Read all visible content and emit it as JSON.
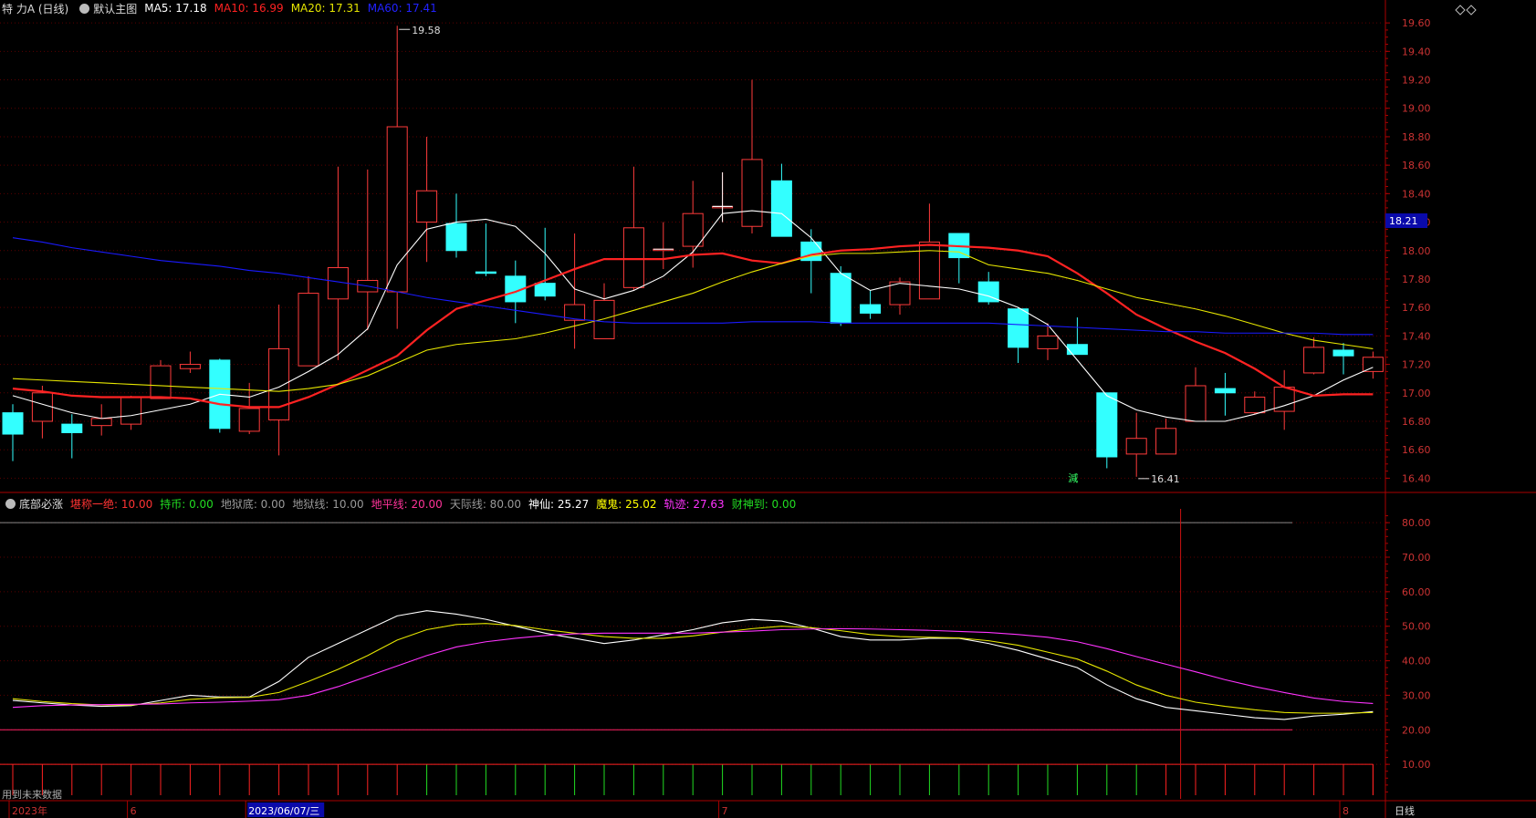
{
  "header_main": {
    "stock": "特 力A (日线)",
    "template": "默认主图",
    "ma5_label": "MA5: 17.18",
    "ma10_label": "MA10: 16.99",
    "ma20_label": "MA20: 17.31",
    "ma60_label": "MA60: 17.41",
    "diamond_icon": "diamond-icon"
  },
  "header_sub": {
    "name": "底部必涨",
    "items": [
      {
        "text": "堪称一绝: 10.00",
        "color": "#ff3333"
      },
      {
        "text": "持币: 0.00",
        "color": "#22dd22"
      },
      {
        "text": "地狱底: 0.00",
        "color": "#999999"
      },
      {
        "text": "地狱线: 10.00",
        "color": "#999999"
      },
      {
        "text": "地平线: 20.00",
        "color": "#ff3399"
      },
      {
        "text": "天际线: 80.00",
        "color": "#999999"
      },
      {
        "text": "神仙: 25.27",
        "color": "#ffffff"
      },
      {
        "text": "魔鬼: 25.02",
        "color": "#ffff00"
      },
      {
        "text": "轨迹: 27.63",
        "color": "#ff33ff"
      },
      {
        "text": "财神到: 0.00",
        "color": "#22dd22"
      }
    ]
  },
  "annotations": {
    "high_label": "19.58",
    "low_label": "16.41",
    "signal": "減",
    "price_marker": "18.21"
  },
  "footer": {
    "no_future": "用到未来数据",
    "period": "日线",
    "x_labels": [
      {
        "text": "2023年",
        "idx": 0
      },
      {
        "text": "6",
        "idx": 4
      },
      {
        "text": "2023/06/07/三",
        "idx": 8
      },
      {
        "text": "7",
        "idx": 24
      },
      {
        "text": "8",
        "idx": 45
      }
    ]
  },
  "chart_data": [
    {
      "type": "candlestick",
      "ylim": [
        16.3,
        19.62
      ],
      "yticks": [
        16.4,
        16.6,
        16.8,
        17.0,
        17.2,
        17.4,
        17.6,
        17.8,
        18.0,
        18.2,
        18.4,
        18.6,
        18.8,
        19.0,
        19.2,
        19.4,
        19.6
      ],
      "candles": [
        {
          "o": 16.86,
          "c": 16.71,
          "h": 16.92,
          "l": 16.52
        },
        {
          "o": 16.8,
          "c": 17.0,
          "h": 17.05,
          "l": 16.68
        },
        {
          "o": 16.78,
          "c": 16.72,
          "h": 16.85,
          "l": 16.54
        },
        {
          "o": 16.77,
          "c": 16.82,
          "h": 16.92,
          "l": 16.7
        },
        {
          "o": 16.78,
          "c": 16.97,
          "h": 16.98,
          "l": 16.74
        },
        {
          "o": 16.96,
          "c": 17.19,
          "h": 17.23,
          "l": 16.96
        },
        {
          "o": 17.17,
          "c": 17.2,
          "h": 17.29,
          "l": 17.14
        },
        {
          "o": 17.23,
          "c": 16.75,
          "h": 17.24,
          "l": 16.72
        },
        {
          "o": 16.73,
          "c": 16.89,
          "h": 17.07,
          "l": 16.71
        },
        {
          "o": 16.81,
          "c": 17.31,
          "h": 17.62,
          "l": 16.56
        },
        {
          "o": 17.19,
          "c": 17.7,
          "h": 17.82,
          "l": 17.19
        },
        {
          "o": 17.66,
          "c": 17.88,
          "h": 18.59,
          "l": 17.23
        },
        {
          "o": 17.71,
          "c": 17.79,
          "h": 18.57,
          "l": 17.44
        },
        {
          "o": 17.71,
          "c": 18.87,
          "h": 19.58,
          "l": 17.45
        },
        {
          "o": 18.2,
          "c": 18.42,
          "h": 18.8,
          "l": 17.92
        },
        {
          "o": 18.19,
          "c": 18.0,
          "h": 18.4,
          "l": 17.95
        },
        {
          "o": 17.85,
          "c": 17.84,
          "h": 18.19,
          "l": 17.82
        },
        {
          "o": 17.82,
          "c": 17.64,
          "h": 17.93,
          "l": 17.49
        },
        {
          "o": 17.77,
          "c": 17.68,
          "h": 18.16,
          "l": 17.65
        },
        {
          "o": 17.51,
          "c": 17.62,
          "h": 18.12,
          "l": 17.31
        },
        {
          "o": 17.38,
          "c": 17.65,
          "h": 17.77,
          "l": 17.38
        },
        {
          "o": 17.74,
          "c": 18.16,
          "h": 18.59,
          "l": 17.72
        },
        {
          "o": 18.01,
          "c": 18.01,
          "h": 18.2,
          "l": 17.87
        },
        {
          "o": 18.03,
          "c": 18.26,
          "h": 18.49,
          "l": 17.88
        },
        {
          "o": 18.31,
          "c": 18.31,
          "h": 18.55,
          "l": 18.2
        },
        {
          "o": 18.17,
          "c": 18.64,
          "h": 19.2,
          "l": 18.12
        },
        {
          "o": 18.49,
          "c": 18.1,
          "h": 18.61,
          "l": 18.1
        },
        {
          "o": 18.06,
          "c": 17.93,
          "h": 18.15,
          "l": 17.7
        },
        {
          "o": 17.84,
          "c": 17.49,
          "h": 17.89,
          "l": 17.47
        },
        {
          "o": 17.62,
          "c": 17.56,
          "h": 17.72,
          "l": 17.52
        },
        {
          "o": 17.62,
          "c": 17.78,
          "h": 17.81,
          "l": 17.55
        },
        {
          "o": 17.66,
          "c": 18.06,
          "h": 18.33,
          "l": 17.66
        },
        {
          "o": 18.12,
          "c": 17.95,
          "h": 18.12,
          "l": 17.77
        },
        {
          "o": 17.78,
          "c": 17.64,
          "h": 17.85,
          "l": 17.62
        },
        {
          "o": 17.59,
          "c": 17.32,
          "h": 17.6,
          "l": 17.21
        },
        {
          "o": 17.31,
          "c": 17.4,
          "h": 17.49,
          "l": 17.23
        },
        {
          "o": 17.34,
          "c": 17.27,
          "h": 17.53,
          "l": 17.27
        },
        {
          "o": 17.0,
          "c": 16.55,
          "h": 17.0,
          "l": 16.47
        },
        {
          "o": 16.57,
          "c": 16.68,
          "h": 16.86,
          "l": 16.41
        },
        {
          "o": 16.57,
          "c": 16.75,
          "h": 16.82,
          "l": 16.57
        },
        {
          "o": 16.8,
          "c": 17.05,
          "h": 17.18,
          "l": 16.8
        },
        {
          "o": 17.03,
          "c": 17.0,
          "h": 17.14,
          "l": 16.84
        },
        {
          "o": 16.86,
          "c": 16.97,
          "h": 17.01,
          "l": 16.85
        },
        {
          "o": 16.87,
          "c": 17.04,
          "h": 17.16,
          "l": 16.74
        },
        {
          "o": 17.14,
          "c": 17.32,
          "h": 17.39,
          "l": 17.13
        },
        {
          "o": 17.3,
          "c": 17.26,
          "h": 17.35,
          "l": 17.13
        },
        {
          "o": 17.15,
          "c": 17.25,
          "h": 17.29,
          "l": 17.1
        }
      ],
      "series": [
        {
          "name": "MA5",
          "color": "#ffffff",
          "values": [
            16.98,
            16.92,
            16.86,
            16.82,
            16.84,
            16.88,
            16.92,
            16.99,
            16.97,
            17.04,
            17.15,
            17.27,
            17.45,
            17.9,
            18.15,
            18.2,
            18.22,
            18.17,
            17.98,
            17.73,
            17.66,
            17.72,
            17.82,
            17.99,
            18.26,
            18.28,
            18.26,
            18.09,
            17.84,
            17.72,
            17.77,
            17.75,
            17.73,
            17.68,
            17.6,
            17.48,
            17.23,
            16.98,
            16.88,
            16.83,
            16.8,
            16.8,
            16.85,
            16.91,
            16.98,
            17.09,
            17.18
          ]
        },
        {
          "name": "MA10",
          "color": "#ff2222",
          "values": [
            17.03,
            17.01,
            16.98,
            16.97,
            16.97,
            16.97,
            16.96,
            16.92,
            16.9,
            16.9,
            16.97,
            17.06,
            17.16,
            17.26,
            17.44,
            17.59,
            17.65,
            17.71,
            17.79,
            17.87,
            17.94,
            17.94,
            17.94,
            17.97,
            17.98,
            17.93,
            17.91,
            17.97,
            18.0,
            18.01,
            18.03,
            18.04,
            18.03,
            18.02,
            18.0,
            17.96,
            17.84,
            17.7,
            17.55,
            17.45,
            17.36,
            17.28,
            17.17,
            17.04,
            16.98,
            16.99,
            16.99
          ]
        },
        {
          "name": "MA20",
          "color": "#e6e600",
          "values": [
            17.1,
            17.09,
            17.08,
            17.07,
            17.06,
            17.05,
            17.04,
            17.03,
            17.02,
            17.01,
            17.03,
            17.06,
            17.12,
            17.21,
            17.3,
            17.34,
            17.36,
            17.38,
            17.42,
            17.47,
            17.52,
            17.58,
            17.64,
            17.7,
            17.78,
            17.85,
            17.91,
            17.96,
            17.98,
            17.98,
            17.99,
            18.0,
            17.99,
            17.9,
            17.87,
            17.84,
            17.79,
            17.73,
            17.67,
            17.63,
            17.59,
            17.54,
            17.48,
            17.42,
            17.37,
            17.34,
            17.31
          ]
        },
        {
          "name": "MA60",
          "color": "#1a1aff",
          "values": [
            18.09,
            18.06,
            18.02,
            17.99,
            17.96,
            17.93,
            17.91,
            17.89,
            17.86,
            17.84,
            17.81,
            17.78,
            17.75,
            17.71,
            17.67,
            17.64,
            17.61,
            17.58,
            17.55,
            17.52,
            17.5,
            17.49,
            17.49,
            17.49,
            17.49,
            17.5,
            17.5,
            17.5,
            17.49,
            17.49,
            17.49,
            17.49,
            17.49,
            17.49,
            17.48,
            17.47,
            17.46,
            17.45,
            17.44,
            17.43,
            17.43,
            17.42,
            17.42,
            17.42,
            17.42,
            17.41,
            17.41
          ]
        }
      ]
    },
    {
      "type": "line",
      "ylim": [
        0,
        84
      ],
      "yticks": [
        10,
        20,
        30,
        40,
        50,
        60,
        70,
        80
      ],
      "reference_lines": [
        {
          "value": 80,
          "color": "#888888"
        },
        {
          "value": 20,
          "color": "#ff2266"
        },
        {
          "value": 10,
          "color": "#ff2222"
        }
      ],
      "signal_bars": [
        "red",
        "red",
        "red",
        "red",
        "red",
        "red",
        "red",
        "red",
        "red",
        "red",
        "red",
        "red",
        "red",
        "red",
        "green",
        "green",
        "green",
        "green",
        "green",
        "green",
        "green",
        "green",
        "green",
        "green",
        "green",
        "green",
        "green",
        "green",
        "green",
        "green",
        "green",
        "green",
        "green",
        "green",
        "green",
        "green",
        "green",
        "green",
        "green",
        "red",
        "red",
        "red",
        "red",
        "red",
        "red",
        "red",
        "red"
      ],
      "series": [
        {
          "name": "神仙",
          "color": "#ffffff",
          "values": [
            28.5,
            27.8,
            27.2,
            26.8,
            27.0,
            28.5,
            30.0,
            29.5,
            29.5,
            34.0,
            41.0,
            45.0,
            49.0,
            53.0,
            54.5,
            53.5,
            52.0,
            50.0,
            48.0,
            46.5,
            45.0,
            46.0,
            47.5,
            49.0,
            51.0,
            52.0,
            51.5,
            49.5,
            47.0,
            46.0,
            46.0,
            46.5,
            46.5,
            45.0,
            43.0,
            40.5,
            38.0,
            33.0,
            29.0,
            26.5,
            25.5,
            24.5,
            23.5,
            23.0,
            24.0,
            24.5,
            25.27
          ]
        },
        {
          "name": "魔鬼",
          "color": "#e6e600",
          "values": [
            29.0,
            28.2,
            27.6,
            27.2,
            27.2,
            27.8,
            28.8,
            29.3,
            29.4,
            30.8,
            34.0,
            37.5,
            41.5,
            46.0,
            49.0,
            50.5,
            50.8,
            50.2,
            49.0,
            48.0,
            47.0,
            46.5,
            46.5,
            47.2,
            48.3,
            49.3,
            50.0,
            49.6,
            48.7,
            47.6,
            47.0,
            46.8,
            46.6,
            45.8,
            44.5,
            42.5,
            40.5,
            37.0,
            33.0,
            30.0,
            28.0,
            26.8,
            25.8,
            25.0,
            24.8,
            24.8,
            25.02
          ]
        },
        {
          "name": "轨迹",
          "color": "#ff33ff",
          "values": [
            26.5,
            27.0,
            27.2,
            27.3,
            27.4,
            27.5,
            27.8,
            28.0,
            28.3,
            28.7,
            30.0,
            32.5,
            35.5,
            38.5,
            41.5,
            44.0,
            45.5,
            46.5,
            47.3,
            47.8,
            48.0,
            48.0,
            48.0,
            48.0,
            48.3,
            48.6,
            49.0,
            49.2,
            49.3,
            49.2,
            49.0,
            48.8,
            48.5,
            48.2,
            47.6,
            46.8,
            45.5,
            43.5,
            41.2,
            39.0,
            36.8,
            34.5,
            32.5,
            30.8,
            29.2,
            28.2,
            27.63
          ]
        }
      ]
    }
  ]
}
